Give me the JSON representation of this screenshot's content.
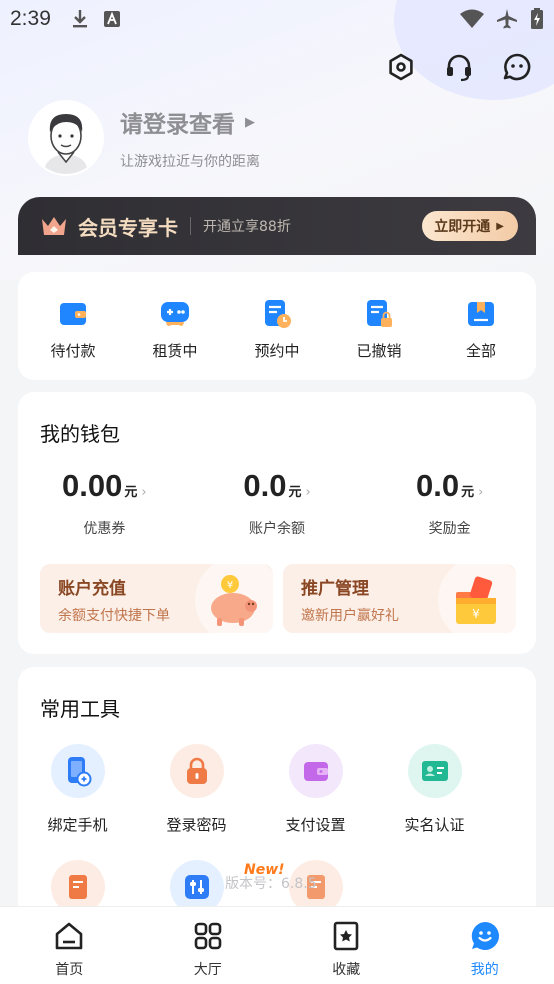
{
  "status_bar": {
    "time": "2:39"
  },
  "profile": {
    "login_title": "请登录查看",
    "login_subtitle": "让游戏拉近与你的距离"
  },
  "vip": {
    "title": "会员专享卡",
    "desc": "开通立享88折",
    "button": "立即开通"
  },
  "orders": [
    {
      "label": "待付款",
      "icon": "wallet-card-icon"
    },
    {
      "label": "租赁中",
      "icon": "gamepad-icon"
    },
    {
      "label": "预约中",
      "icon": "document-clock-icon"
    },
    {
      "label": "已撤销",
      "icon": "document-lock-icon"
    },
    {
      "label": "全部",
      "icon": "bookmark-box-icon"
    }
  ],
  "wallet": {
    "title": "我的钱包",
    "stats": [
      {
        "value": "0.00",
        "unit": "元",
        "label": "优惠券"
      },
      {
        "value": "0.0",
        "unit": "元",
        "label": "账户余额"
      },
      {
        "value": "0.0",
        "unit": "元",
        "label": "奖励金"
      }
    ],
    "promos": [
      {
        "title": "账户充值",
        "subtitle": "余额支付快捷下单",
        "icon": "piggy-bank-icon"
      },
      {
        "title": "推广管理",
        "subtitle": "邀新用户赢好礼",
        "icon": "gift-box-icon"
      }
    ]
  },
  "tools": {
    "title": "常用工具",
    "items": [
      {
        "label": "绑定手机",
        "icon": "phone-link-icon"
      },
      {
        "label": "登录密码",
        "icon": "lock-icon"
      },
      {
        "label": "支付设置",
        "icon": "wallet-icon"
      },
      {
        "label": "实名认证",
        "icon": "id-card-icon"
      }
    ],
    "row2_icons": [
      "edit-document-icon",
      "sliders-icon",
      "edit-note-icon"
    ],
    "version": "版本号：6.8.5",
    "new_badge": "New!"
  },
  "tabbar": [
    {
      "label": "首页",
      "icon": "home-icon",
      "active": false
    },
    {
      "label": "大厅",
      "icon": "grid-icon",
      "active": false
    },
    {
      "label": "收藏",
      "icon": "star-bookmark-icon",
      "active": false
    },
    {
      "label": "我的",
      "icon": "smile-chat-icon",
      "active": true
    }
  ],
  "colors": {
    "accent": "#1e88ff",
    "vip_gold": "#f4dcc0",
    "promo_bg": "#fcefe7"
  }
}
